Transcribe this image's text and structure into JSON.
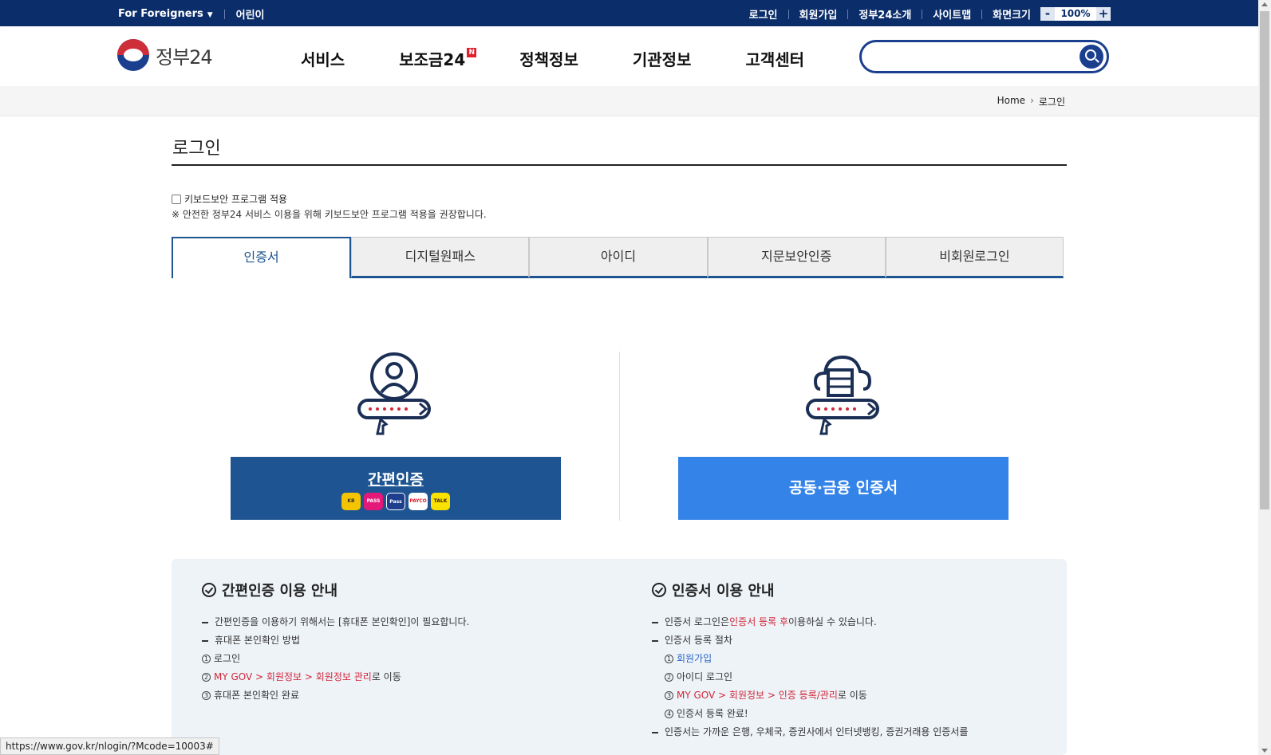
{
  "topbar": {
    "foreigners": "For Foreigners",
    "kids": "어린이",
    "links": [
      "로그인",
      "회원가입",
      "정부24소개",
      "사이트맵"
    ],
    "zoom_label": "화면크기",
    "zoom_minus": "-",
    "zoom_value": "100%",
    "zoom_plus": "+"
  },
  "header": {
    "logo_text": "정부24",
    "nav": [
      "서비스",
      "보조금24",
      "정책정보",
      "기관정보",
      "고객센터"
    ],
    "new_badge": "N",
    "search_placeholder": ""
  },
  "breadcrumb": {
    "home": "Home",
    "current": "로그인"
  },
  "page": {
    "title": "로그인",
    "keyboard_security": "키보드보안 프로그램 적용",
    "keyboard_note": "※ 안전한 정부24 서비스 이용을 위해 키보드보안 프로그램 적용을 권장합니다."
  },
  "tabs": [
    "인증서",
    "디지털원패스",
    "아이디",
    "지문보안인증",
    "비회원로그인"
  ],
  "login": {
    "simple_auth": "간편인증",
    "cert_auth": "공동·금융 인증서",
    "provider_logos": [
      "KB",
      "PASS",
      "Pass",
      "PAYCO",
      "TALK"
    ]
  },
  "guide": {
    "simple_title": "간편인증 이용 안내",
    "simple_lines": [
      "간편인증을 이용하기 위해서는 [휴대폰 본인확인]이 필요합니다.",
      "휴대폰 본인확인 방법"
    ],
    "simple_steps": {
      "s1_num": "1",
      "s1": "로그인",
      "s2_num": "2",
      "s2_red": "MY GOV > 회원정보 > 회원정보 관리",
      "s2_tail": "로 이동",
      "s3_num": "3",
      "s3": "휴대폰 본인확인 완료"
    },
    "cert_title": "인증서 이용 안내",
    "cert_line1_pre": "인증서 로그인은 ",
    "cert_line1_red": "인증서 등록 후",
    "cert_line1_post": " 이용하실 수 있습니다.",
    "cert_line2": "인증서 등록 절차",
    "cert_steps": {
      "c1_num": "1",
      "c1_blue": "회원가입",
      "c2_num": "2",
      "c2": "아이디 로그인",
      "c3_num": "3",
      "c3_red": "MY GOV > 회원정보 > 인증 등록/관리",
      "c3_tail": "로 이동",
      "c4_num": "4",
      "c4": "인증서 등록 완료!"
    },
    "cert_line3": "인증서는 가까운 은행, 우체국, 증권사에서 인터넷뱅킹, 증권거래용 인증서를"
  },
  "status_url": "https://www.gov.kr/nlogin/?Mcode=10003#"
}
